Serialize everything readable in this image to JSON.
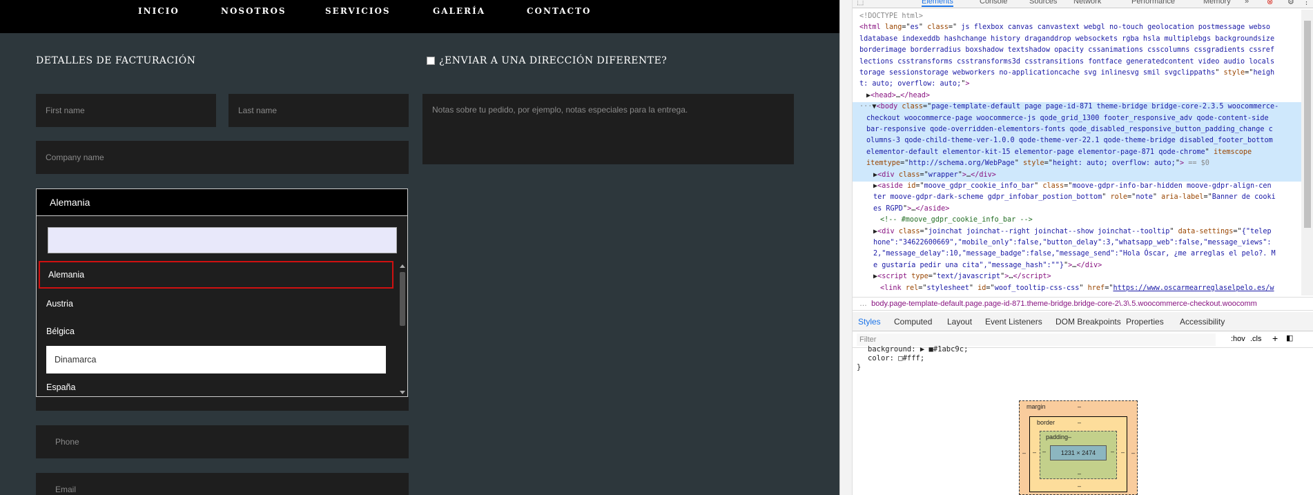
{
  "nav": {
    "items": [
      "INICIO",
      "NOSOTROS",
      "SERVICIOS",
      "GALERÍA",
      "CONTACTO"
    ]
  },
  "billing": {
    "heading": "DETALLES DE FACTURACIÓN",
    "first_name_placeholder": "First name",
    "last_name_placeholder": "Last name",
    "company_placeholder": "Company name",
    "phone_placeholder": "Phone",
    "email_placeholder": "Email"
  },
  "shipping": {
    "heading": "¿ENVIAR A UNA DIRECCIÓN DIFERENTE?",
    "notes_placeholder": "Notas sobre tu pedido, por ejemplo, notas especiales para la entrega."
  },
  "country": {
    "selected": "Alemania",
    "search_value": "",
    "options": [
      "Alemania",
      "Austria",
      "Bélgica",
      "Dinamarca",
      "España"
    ],
    "selected_index": 0,
    "highlighted_index": 3
  },
  "devtools": {
    "tabs": [
      "Elements",
      "Console",
      "Sources",
      "Network",
      "Performance",
      "Memory",
      "»"
    ],
    "active_tab": "Elements",
    "dom_lines": [
      {
        "indent": 0,
        "html": "<span class='gr'>&lt;!DOCTYPE html&gt;</span>"
      },
      {
        "indent": 0,
        "html": "<span class='tg'>&lt;html</span> <span class='at'>lang</span>=\"<span class='av'>es</span>\" <span class='at'>class</span>=\"<span class='av'> js flexbox canvas canvastext webgl no-touch geolocation postmessage webso</span>"
      },
      {
        "indent": 0,
        "html": "<span class='av'>ldatabase indexeddb hashchange history draganddrop websockets rgba hsla multiplebgs backgroundsize</span>"
      },
      {
        "indent": 0,
        "html": "<span class='av'>borderimage borderradius boxshadow textshadow opacity cssanimations csscolumns cssgradients cssref</span>"
      },
      {
        "indent": 0,
        "html": "<span class='av'>lections csstransforms csstransforms3d csstransitions fontface generatedcontent video audio locals</span>"
      },
      {
        "indent": 0,
        "html": "<span class='av'>torage sessionstorage webworkers no-applicationcache svg inlinesvg smil svgclippaths</span>\" <span class='at'>style</span>=\"<span class='av'>heigh</span>"
      },
      {
        "indent": 0,
        "html": "<span class='av'>t: auto; overflow: auto;</span>\"<span class='tg'>&gt;</span>"
      },
      {
        "indent": 1,
        "html": "▶<span class='tg'>&lt;head&gt;</span>…<span class='tg'>&lt;/head&gt;</span>"
      },
      {
        "indent": 0,
        "html": "<span class='gr'>···</span>▼<span class='tg'>&lt;body</span> <span class='at'>class</span>=\"<span class='av'>page-template-default page page-id-871 theme-bridge bridge-core-2.3.5 woocommerce-</span>"
      },
      {
        "indent": 1,
        "html": "<span class='av'>checkout woocommerce-page woocommerce-js  qode_grid_1300 footer_responsive_adv qode-content-side</span>"
      },
      {
        "indent": 1,
        "html": "<span class='av'>bar-responsive qode-overridden-elementors-fonts qode_disabled_responsive_button_padding_change c</span>"
      },
      {
        "indent": 1,
        "html": "<span class='av'>olumns-3 qode-child-theme-ver-1.0.0 qode-theme-ver-22.1 qode-theme-bridge disabled_footer_bottom</span>"
      },
      {
        "indent": 1,
        "html": "<span class='av'>elementor-default elementor-kit-15 elementor-page elementor-page-871 qode-chrome</span>\" <span class='at'>itemscope</span>"
      },
      {
        "indent": 1,
        "html": "<span class='at'>itemtype</span>=\"<span class='av'>http://schema.org/WebPage</span>\" <span class='at'>style</span>=\"<span class='av'>height: auto; overflow: auto;</span>\"<span class='tg'>&gt;</span> <span class='gr'>== $0</span>"
      },
      {
        "indent": 2,
        "html": "▶<span class='tg'>&lt;div</span> <span class='at'>class</span>=\"<span class='av'>wrapper</span>\"<span class='tg'>&gt;</span>…<span class='tg'>&lt;/div&gt;</span>"
      },
      {
        "indent": 2,
        "html": "▶<span class='tg'>&lt;aside</span> <span class='at'>id</span>=\"<span class='av'>moove_gdpr_cookie_info_bar</span>\" <span class='at'>class</span>=\"<span class='av'>moove-gdpr-info-bar-hidden moove-gdpr-align-cen</span>"
      },
      {
        "indent": 2,
        "html": "<span class='av'>ter moove-gdpr-dark-scheme gdpr_infobar_postion_bottom</span>\" <span class='at'>role</span>=\"<span class='av'>note</span>\" <span class='at'>aria-label</span>=\"<span class='av'>Banner de cooki</span>"
      },
      {
        "indent": 2,
        "html": "<span class='av'>es RGPD</span>\"<span class='tg'>&gt;</span>…<span class='tg'>&lt;/aside&gt;</span>"
      },
      {
        "indent": 3,
        "html": "<span class='cm'>&lt;!-- #moove_gdpr_cookie_info_bar  --&gt;</span>"
      },
      {
        "indent": 2,
        "html": "▶<span class='tg'>&lt;div</span> <span class='at'>class</span>=\"<span class='av'>joinchat joinchat--right joinchat--show joinchat--tooltip</span>\" <span class='at'>data-settings</span>=\"<span class='av'>{\"telep</span>"
      },
      {
        "indent": 2,
        "html": "<span class='av'>hone\":\"34622600669\",\"mobile_only\":false,\"button_delay\":3,\"whatsapp_web\":false,\"message_views\":</span>"
      },
      {
        "indent": 2,
        "html": "<span class='av'>2,\"message_delay\":10,\"message_badge\":false,\"message_send\":\"Hola Óscar, ¿me arreglas el pelo?. M</span>"
      },
      {
        "indent": 2,
        "html": "<span class='av'>e gustaría pedir una cita\",\"message_hash\":\"\"}</span>\"<span class='tg'>&gt;</span>…<span class='tg'>&lt;/div&gt;</span>"
      },
      {
        "indent": 2,
        "html": "▶<span class='tg'>&lt;script</span> <span class='at'>type</span>=\"<span class='av'>text/javascript</span>\"<span class='tg'>&gt;</span>…<span class='tg'>&lt;/script&gt;</span>"
      },
      {
        "indent": 3,
        "html": "<span class='tg'>&lt;link</span> <span class='at'>rel</span>=\"<span class='av'>stylesheet</span>\" <span class='at'>id</span>=\"<span class='av'>woof_tooltip-css-css</span>\" <span class='at'>href</span>=\"<span class='lnk'>https://www.oscarmearreglaselpelo.es/w</span>"
      }
    ],
    "breadcrumb": "body.page-template-default.page.page-id-871.theme-bridge.bridge-core-2\\.3\\.5.woocommerce-checkout.woocomm",
    "style_tabs": [
      "Styles",
      "Computed",
      "Layout",
      "Event Listeners",
      "DOM Breakpoints",
      "Properties",
      "Accessibility"
    ],
    "active_style_tab": "Styles",
    "filter_placeholder": "Filter",
    "hov_label": ":hov",
    "cls_label": ".cls",
    "style_lines": [
      "background: ▶ ■#1abc9c;",
      "color: □#fff;",
      "}"
    ],
    "box_model": {
      "margin_label": "margin",
      "border_label": "border",
      "padding_label": "padding",
      "dash": "–",
      "content_size": "1231 × 2474"
    }
  }
}
